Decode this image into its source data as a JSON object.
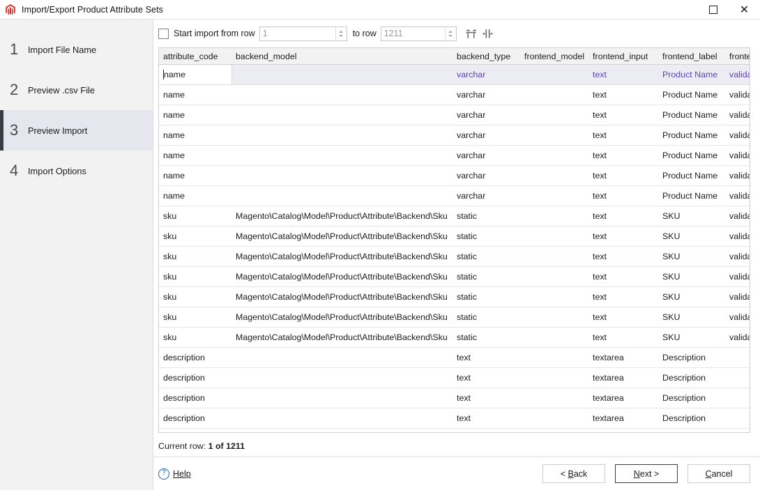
{
  "window": {
    "title": "Import/Export Product Attribute Sets",
    "app_icon": "magento-icon",
    "maximize_label": "Maximize",
    "close_label": "Close"
  },
  "sidebar": {
    "items": [
      {
        "num": "1",
        "label": "Import File Name",
        "active": false
      },
      {
        "num": "2",
        "label": "Preview .csv File",
        "active": false
      },
      {
        "num": "3",
        "label": "Preview Import",
        "active": true
      },
      {
        "num": "4",
        "label": "Import Options",
        "active": false
      }
    ]
  },
  "toolbar": {
    "start_checkbox_checked": false,
    "start_label": "Start import from row",
    "from_value": "1",
    "to_label": "to row",
    "to_value": "1211",
    "fit_columns_icon": "fit-columns-icon",
    "column_width_icon": "column-width-icon"
  },
  "table": {
    "columns": [
      {
        "key": "attribute_code",
        "label": "attribute_code",
        "cls": "c-attr"
      },
      {
        "key": "backend_model",
        "label": "backend_model",
        "cls": "c-bem"
      },
      {
        "key": "backend_type",
        "label": "backend_type",
        "cls": "c-bty"
      },
      {
        "key": "frontend_model",
        "label": "frontend_model",
        "cls": "c-fmo"
      },
      {
        "key": "frontend_input",
        "label": "frontend_input",
        "cls": "c-fin"
      },
      {
        "key": "frontend_label",
        "label": "frontend_label",
        "cls": "c-fla"
      },
      {
        "key": "frontend_class",
        "label": "frontend_class",
        "cls": "c-fcl"
      }
    ],
    "rows": [
      {
        "selected": true,
        "editing": true,
        "attribute_code": "name",
        "backend_model": "",
        "backend_type": "varchar",
        "frontend_model": "",
        "frontend_input": "text",
        "frontend_label": "Product Name",
        "frontend_class": "validate-length m"
      },
      {
        "attribute_code": "name",
        "backend_model": "",
        "backend_type": "varchar",
        "frontend_model": "",
        "frontend_input": "text",
        "frontend_label": "Product Name",
        "frontend_class": "validate-length m"
      },
      {
        "attribute_code": "name",
        "backend_model": "",
        "backend_type": "varchar",
        "frontend_model": "",
        "frontend_input": "text",
        "frontend_label": "Product Name",
        "frontend_class": "validate-length m"
      },
      {
        "attribute_code": "name",
        "backend_model": "",
        "backend_type": "varchar",
        "frontend_model": "",
        "frontend_input": "text",
        "frontend_label": "Product Name",
        "frontend_class": "validate-length m"
      },
      {
        "attribute_code": "name",
        "backend_model": "",
        "backend_type": "varchar",
        "frontend_model": "",
        "frontend_input": "text",
        "frontend_label": "Product Name",
        "frontend_class": "validate-length m"
      },
      {
        "attribute_code": "name",
        "backend_model": "",
        "backend_type": "varchar",
        "frontend_model": "",
        "frontend_input": "text",
        "frontend_label": "Product Name",
        "frontend_class": "validate-length m"
      },
      {
        "attribute_code": "name",
        "backend_model": "",
        "backend_type": "varchar",
        "frontend_model": "",
        "frontend_input": "text",
        "frontend_label": "Product Name",
        "frontend_class": "validate-length m"
      },
      {
        "attribute_code": "sku",
        "backend_model": "Magento\\Catalog\\Model\\Product\\Attribute\\Backend\\Sku",
        "backend_type": "static",
        "frontend_model": "",
        "frontend_input": "text",
        "frontend_label": "SKU",
        "frontend_class": "validate-length m"
      },
      {
        "attribute_code": "sku",
        "backend_model": "Magento\\Catalog\\Model\\Product\\Attribute\\Backend\\Sku",
        "backend_type": "static",
        "frontend_model": "",
        "frontend_input": "text",
        "frontend_label": "SKU",
        "frontend_class": "validate-length m"
      },
      {
        "attribute_code": "sku",
        "backend_model": "Magento\\Catalog\\Model\\Product\\Attribute\\Backend\\Sku",
        "backend_type": "static",
        "frontend_model": "",
        "frontend_input": "text",
        "frontend_label": "SKU",
        "frontend_class": "validate-length m"
      },
      {
        "attribute_code": "sku",
        "backend_model": "Magento\\Catalog\\Model\\Product\\Attribute\\Backend\\Sku",
        "backend_type": "static",
        "frontend_model": "",
        "frontend_input": "text",
        "frontend_label": "SKU",
        "frontend_class": "validate-length m"
      },
      {
        "attribute_code": "sku",
        "backend_model": "Magento\\Catalog\\Model\\Product\\Attribute\\Backend\\Sku",
        "backend_type": "static",
        "frontend_model": "",
        "frontend_input": "text",
        "frontend_label": "SKU",
        "frontend_class": "validate-length m"
      },
      {
        "attribute_code": "sku",
        "backend_model": "Magento\\Catalog\\Model\\Product\\Attribute\\Backend\\Sku",
        "backend_type": "static",
        "frontend_model": "",
        "frontend_input": "text",
        "frontend_label": "SKU",
        "frontend_class": "validate-length m"
      },
      {
        "attribute_code": "sku",
        "backend_model": "Magento\\Catalog\\Model\\Product\\Attribute\\Backend\\Sku",
        "backend_type": "static",
        "frontend_model": "",
        "frontend_input": "text",
        "frontend_label": "SKU",
        "frontend_class": "validate-length m"
      },
      {
        "attribute_code": "description",
        "backend_model": "",
        "backend_type": "text",
        "frontend_model": "",
        "frontend_input": "textarea",
        "frontend_label": "Description",
        "frontend_class": ""
      },
      {
        "attribute_code": "description",
        "backend_model": "",
        "backend_type": "text",
        "frontend_model": "",
        "frontend_input": "textarea",
        "frontend_label": "Description",
        "frontend_class": ""
      },
      {
        "attribute_code": "description",
        "backend_model": "",
        "backend_type": "text",
        "frontend_model": "",
        "frontend_input": "textarea",
        "frontend_label": "Description",
        "frontend_class": ""
      },
      {
        "attribute_code": "description",
        "backend_model": "",
        "backend_type": "text",
        "frontend_model": "",
        "frontend_input": "textarea",
        "frontend_label": "Description",
        "frontend_class": ""
      }
    ]
  },
  "status": {
    "prefix": "Current row: ",
    "value": "1 of 1211"
  },
  "footer": {
    "help_label": "Help",
    "help_mnemonic": "H",
    "help_icon": "question-mark-icon",
    "buttons": [
      {
        "name": "back-button",
        "pre": "< ",
        "mn": "B",
        "post": "ack",
        "default": false
      },
      {
        "name": "next-button",
        "pre": "",
        "mn": "N",
        "post": "ext >",
        "default": true
      },
      {
        "name": "cancel-button",
        "pre": "",
        "mn": "C",
        "post": "ancel",
        "default": false
      }
    ]
  },
  "colors": {
    "selection_bg": "#ececf4",
    "selection_text": "#5b3fbf",
    "sidebar_bg": "#f2f2f2",
    "accent_bar": "#3b3b46",
    "help_blue": "#1763b8"
  }
}
